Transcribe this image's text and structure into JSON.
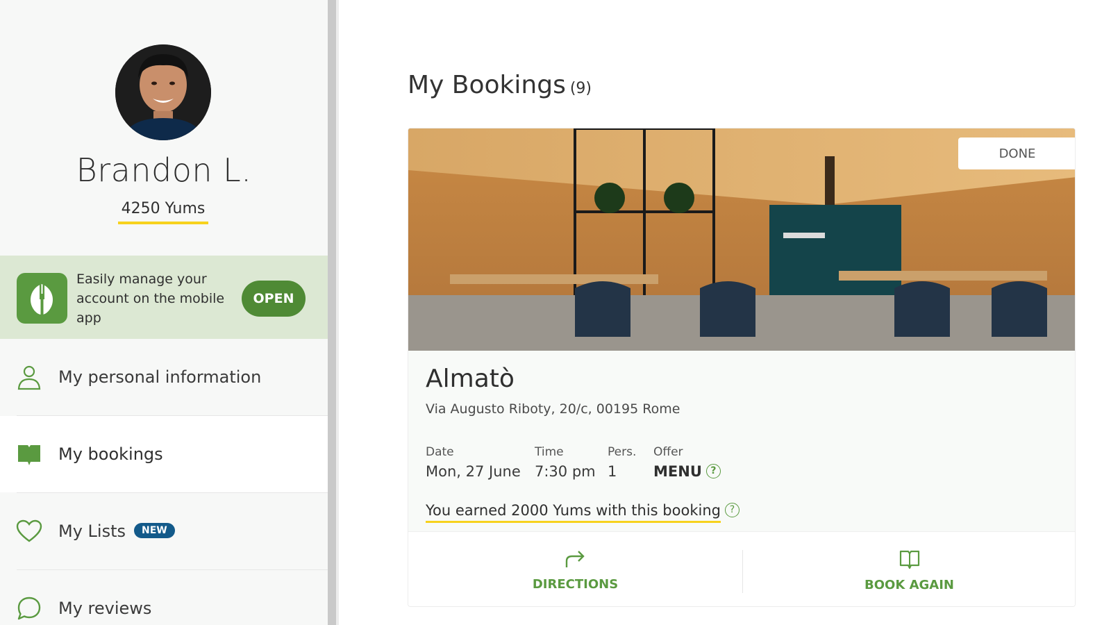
{
  "user": {
    "name": "Brandon L.",
    "yums": "4250 Yums"
  },
  "app_banner": {
    "text": "Easily manage your account on the mobile app",
    "button_label": "OPEN",
    "icon": "fork-leaf-icon"
  },
  "nav": {
    "items": [
      {
        "label": "My personal information",
        "icon": "person-icon"
      },
      {
        "label": "My bookings",
        "icon": "book-icon",
        "active": true
      },
      {
        "label": "My Lists",
        "icon": "heart-icon",
        "badge": "NEW"
      },
      {
        "label": "My reviews",
        "icon": "speech-bubble-icon"
      }
    ]
  },
  "page": {
    "title": "My Bookings",
    "count": "(9)"
  },
  "booking": {
    "status": "DONE",
    "restaurant_name": "Almatò",
    "address": "Via Augusto Riboty, 20/c, 00195 Rome",
    "labels": {
      "date": "Date",
      "time": "Time",
      "persons": "Pers.",
      "offer": "Offer"
    },
    "values": {
      "date": "Mon, 27 June",
      "time": "7:30 pm",
      "persons": "1",
      "offer": "MENU"
    },
    "earned": "You earned 2000 Yums with this booking",
    "actions": {
      "directions": "DIRECTIONS",
      "book_again": "BOOK AGAIN"
    }
  },
  "colors": {
    "brand_green": "#5a9a40",
    "banner_bg": "#dce8d3",
    "yums_underline": "#f7d21d",
    "badge_blue": "#135a8a"
  }
}
